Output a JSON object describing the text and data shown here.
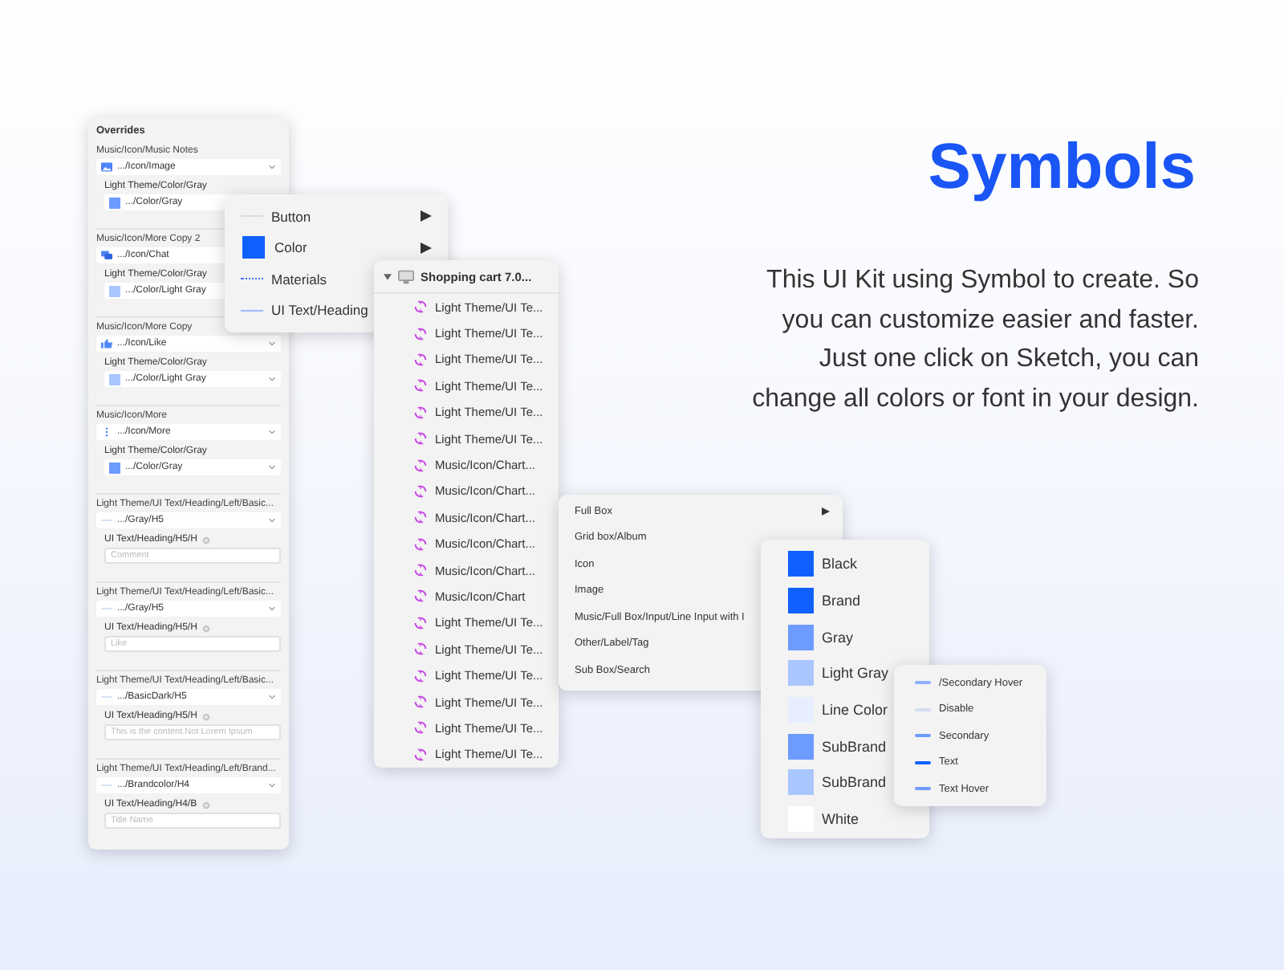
{
  "heading": "Symbols",
  "description": "This UI Kit using Symbol to create. So you can customize easier and faster. Just one click on Sketch, you can change all colors or font in your design.",
  "overrides": {
    "title": "Overrides",
    "groups": [
      {
        "label": "Music/Icon/Music Notes",
        "select": {
          "kind": "image",
          "value": ".../Icon/Image"
        },
        "sub_label": "Light Theme/Color/Gray",
        "sub": {
          "kind": "swatch",
          "color": "#6d9bff",
          "value": ".../Color/Gray"
        }
      },
      {
        "label": "Music/Icon/More Copy 2",
        "select": {
          "kind": "chat",
          "value": ".../Icon/Chat"
        },
        "sub_label": "Light Theme/Color/Gray",
        "sub": {
          "kind": "swatch",
          "color": "#a9c6ff",
          "value": ".../Color/Light Gray"
        }
      },
      {
        "label": "Music/Icon/More Copy",
        "select": {
          "kind": "like",
          "value": ".../Icon/Like"
        },
        "sub_label": "Light Theme/Color/Gray",
        "sub": {
          "kind": "swatch",
          "color": "#a9c6ff",
          "value": ".../Color/Light Gray"
        }
      },
      {
        "label": "Music/Icon/More",
        "select": {
          "kind": "more",
          "value": ".../Icon/More"
        },
        "sub_label": "Light Theme/Color/Gray",
        "sub": {
          "kind": "swatch",
          "color": "#6d9bff",
          "value": ".../Color/Gray"
        }
      },
      {
        "label": "Light Theme/UI Text/Heading/Left/Basic...",
        "select": {
          "kind": "line",
          "value": ".../Gray/H5"
        },
        "sub_label": "UI Text/Heading/H5/H",
        "sub": {
          "kind": "input",
          "placeholder": "Comment"
        }
      },
      {
        "label": "Light Theme/UI Text/Heading/Left/Basic...",
        "select": {
          "kind": "line",
          "value": ".../Gray/H5"
        },
        "sub_label": "UI Text/Heading/H5/H",
        "sub": {
          "kind": "input",
          "placeholder": "Like"
        }
      },
      {
        "label": "Light Theme/UI Text/Heading/Left/Basic...",
        "select": {
          "kind": "line",
          "value": ".../BasicDark/H5"
        },
        "sub_label": "UI Text/Heading/H5/H",
        "sub": {
          "kind": "input",
          "placeholder": "This is the content.Not Lorem Ipsum"
        }
      },
      {
        "label": "Light Theme/UI Text/Heading/Left/Brand...",
        "select": {
          "kind": "line",
          "value": ".../Brandcolor/H4"
        },
        "sub_label": "UI Text/Heading/H4/B",
        "sub": {
          "kind": "input",
          "placeholder": "Title Name"
        }
      }
    ]
  },
  "symbol_menu": {
    "items": [
      {
        "kind": "line",
        "label": "Button",
        "submenu": true
      },
      {
        "kind": "swatch",
        "label": "Color",
        "submenu": true
      },
      {
        "kind": "dotted",
        "label": "Materials",
        "submenu": false
      },
      {
        "kind": "thin",
        "label": "UI Text/Heading",
        "submenu": false
      }
    ]
  },
  "layer_list": {
    "title": "Shopping cart 7.0...",
    "expanded": true,
    "items": [
      "Light Theme/UI Te...",
      "Light Theme/UI Te...",
      "Light Theme/UI Te...",
      "Light Theme/UI Te...",
      "Light Theme/UI Te...",
      "Light Theme/UI Te...",
      "Music/Icon/Chart...",
      "Music/Icon/Chart...",
      "Music/Icon/Chart...",
      "Music/Icon/Chart...",
      "Music/Icon/Chart...",
      "Music/Icon/Chart",
      "Light Theme/UI Te...",
      "Light Theme/UI Te...",
      "Light Theme/UI Te...",
      "Light Theme/UI Te...",
      "Light Theme/UI Te...",
      "Light Theme/UI Te..."
    ]
  },
  "box_menu": {
    "items": [
      {
        "label": "Full Box",
        "submenu": true
      },
      {
        "label": "Grid box/Album",
        "submenu": false
      },
      {
        "label": "Icon",
        "submenu": false
      },
      {
        "label": "Image",
        "submenu": false
      },
      {
        "label": "Music/Full Box/Input/Line Input with I",
        "submenu": false
      },
      {
        "label": "Other/Label/Tag",
        "submenu": false
      },
      {
        "label": "Sub Box/Search",
        "submenu": false
      }
    ]
  },
  "color_menu": {
    "items": [
      {
        "label": "Black",
        "color": "#1060ff"
      },
      {
        "label": "Brand",
        "color": "#1060ff"
      },
      {
        "label": "Gray",
        "color": "#6d9bff"
      },
      {
        "label": "Light Gray",
        "color": "#a9c6ff"
      },
      {
        "label": "Line Color",
        "color": "#e6eeff"
      },
      {
        "label": "SubBrand",
        "color": "#6d9bff"
      },
      {
        "label": "SubBrand",
        "color": "#a9c6ff"
      },
      {
        "label": "White",
        "color": "#ffffff"
      }
    ]
  },
  "text_menu": {
    "items": [
      {
        "label": "/Secondary Hover",
        "color": "#8fb0ff"
      },
      {
        "label": "Disable",
        "color": "#d3ddf0"
      },
      {
        "label": "Secondary",
        "color": "#6d9bff"
      },
      {
        "label": "Text",
        "color": "#1060ff"
      },
      {
        "label": "Text Hover",
        "color": "#6d9bff"
      }
    ]
  }
}
